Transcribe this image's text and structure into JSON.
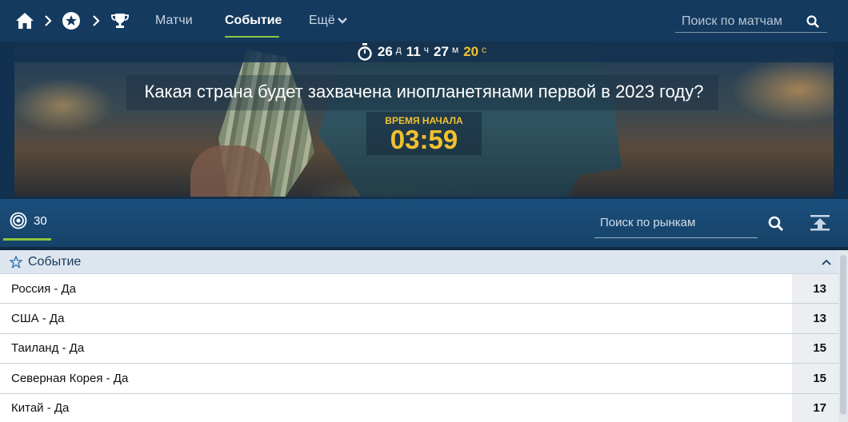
{
  "nav": {
    "items": [
      "Матчи",
      "Событие",
      "Ещё"
    ],
    "active": "Событие",
    "search_placeholder": "Поиск по матчам",
    "accent_color": "#8cc63f"
  },
  "banner": {
    "countdown": {
      "days": "26",
      "days_unit": "д",
      "hours": "11",
      "hours_unit": "ч",
      "minutes": "27",
      "minutes_unit": "м",
      "seconds": "20",
      "seconds_unit": "с"
    },
    "question": "Какая страна будет захвачена инопланетянами первой в 2023 году?",
    "start_label": "ВРЕМЯ НАЧАЛА",
    "start_time": "03:59"
  },
  "markets": {
    "count": "30",
    "search_placeholder": "Поиск по рынкам"
  },
  "group": {
    "title": "Событие",
    "rows": [
      {
        "name": "Россия - Да",
        "odds": "13"
      },
      {
        "name": "США - Да",
        "odds": "13"
      },
      {
        "name": "Таиланд - Да",
        "odds": "15"
      },
      {
        "name": "Северная Корея - Да",
        "odds": "15"
      },
      {
        "name": "Китай - Да",
        "odds": "17"
      }
    ]
  }
}
